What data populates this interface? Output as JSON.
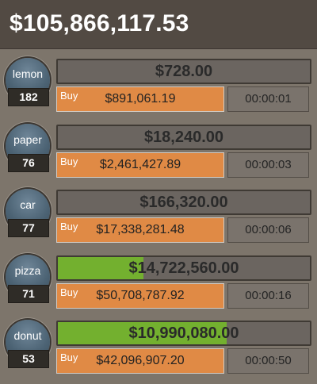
{
  "header": {
    "total": "$105,866,117.53"
  },
  "colors": {
    "header_bg": "#524a43",
    "background": "#7d756b",
    "progress_fill": "#73b02f",
    "buy_button": "#e08a45",
    "avatar": "#4c6374"
  },
  "businesses": [
    {
      "name": "lemon",
      "count": "182",
      "revenue": "$728.00",
      "buy_label": "Buy",
      "cost": "$891,061.19",
      "timer": "00:00:01",
      "progress": 0
    },
    {
      "name": "paper",
      "count": "76",
      "revenue": "$18,240.00",
      "buy_label": "Buy",
      "cost": "$2,461,427.89",
      "timer": "00:00:03",
      "progress": 0
    },
    {
      "name": "car",
      "count": "77",
      "revenue": "$166,320.00",
      "buy_label": "Buy",
      "cost": "$17,338,281.48",
      "timer": "00:00:06",
      "progress": 0
    },
    {
      "name": "pizza",
      "count": "71",
      "revenue": "$14,722,560.00",
      "buy_label": "Buy",
      "cost": "$50,708,787.92",
      "timer": "00:00:16",
      "progress": 0.34
    },
    {
      "name": "donut",
      "count": "53",
      "revenue": "$10,990,080.00",
      "buy_label": "Buy",
      "cost": "$42,096,907.20",
      "timer": "00:00:50",
      "progress": 0.67
    }
  ]
}
